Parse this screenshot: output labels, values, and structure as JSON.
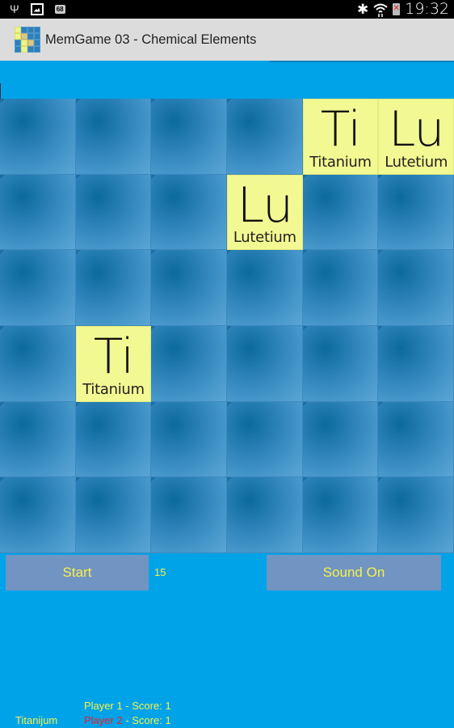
{
  "status_bar": {
    "icons_left": [
      "usb-icon",
      "picture-icon",
      "battery-level-icon"
    ],
    "battery_level_text": "68",
    "icons_right": [
      "bluetooth-icon",
      "wifi-icon",
      "battery-alert-icon"
    ],
    "time": "19:32"
  },
  "action_bar": {
    "title": "MemGame 03 - Chemical Elements",
    "icon": "app-icon"
  },
  "board": {
    "rows": 6,
    "cols": 6,
    "tiles": [
      [
        {
          "state": "hidden"
        },
        {
          "state": "hidden"
        },
        {
          "state": "hidden"
        },
        {
          "state": "hidden"
        },
        {
          "state": "open",
          "symbol": "Ti",
          "name": "Titanium"
        },
        {
          "state": "open",
          "symbol": "Lu",
          "name": "Lutetium"
        }
      ],
      [
        {
          "state": "hidden"
        },
        {
          "state": "hidden"
        },
        {
          "state": "hidden"
        },
        {
          "state": "open",
          "symbol": "Lu",
          "name": "Lutetium"
        },
        {
          "state": "hidden"
        },
        {
          "state": "hidden"
        }
      ],
      [
        {
          "state": "hidden"
        },
        {
          "state": "hidden"
        },
        {
          "state": "hidden"
        },
        {
          "state": "hidden"
        },
        {
          "state": "hidden"
        },
        {
          "state": "hidden"
        }
      ],
      [
        {
          "state": "hidden"
        },
        {
          "state": "open",
          "symbol": "Ti",
          "name": "Titanium"
        },
        {
          "state": "hidden"
        },
        {
          "state": "hidden"
        },
        {
          "state": "hidden"
        },
        {
          "state": "hidden"
        }
      ],
      [
        {
          "state": "hidden"
        },
        {
          "state": "hidden"
        },
        {
          "state": "hidden"
        },
        {
          "state": "hidden"
        },
        {
          "state": "hidden"
        },
        {
          "state": "hidden"
        }
      ],
      [
        {
          "state": "hidden"
        },
        {
          "state": "hidden"
        },
        {
          "state": "hidden"
        },
        {
          "state": "hidden"
        },
        {
          "state": "hidden"
        },
        {
          "state": "hidden"
        }
      ]
    ]
  },
  "controls": {
    "start_label": "Start",
    "counter": "15",
    "sound_label": "Sound On"
  },
  "footer": {
    "last_word": "Titanijum",
    "player1": {
      "name": "Player 1",
      "score_text": " - Score: 1"
    },
    "player2": {
      "name": "Player 2",
      "score_text": " - Score: 1"
    }
  },
  "colors": {
    "background": "#00a3e8",
    "button_bg": "#7294c2",
    "text_yellow": "#f6f24a",
    "active_player_red": "#e8202e",
    "open_tile": "#f2f992"
  }
}
